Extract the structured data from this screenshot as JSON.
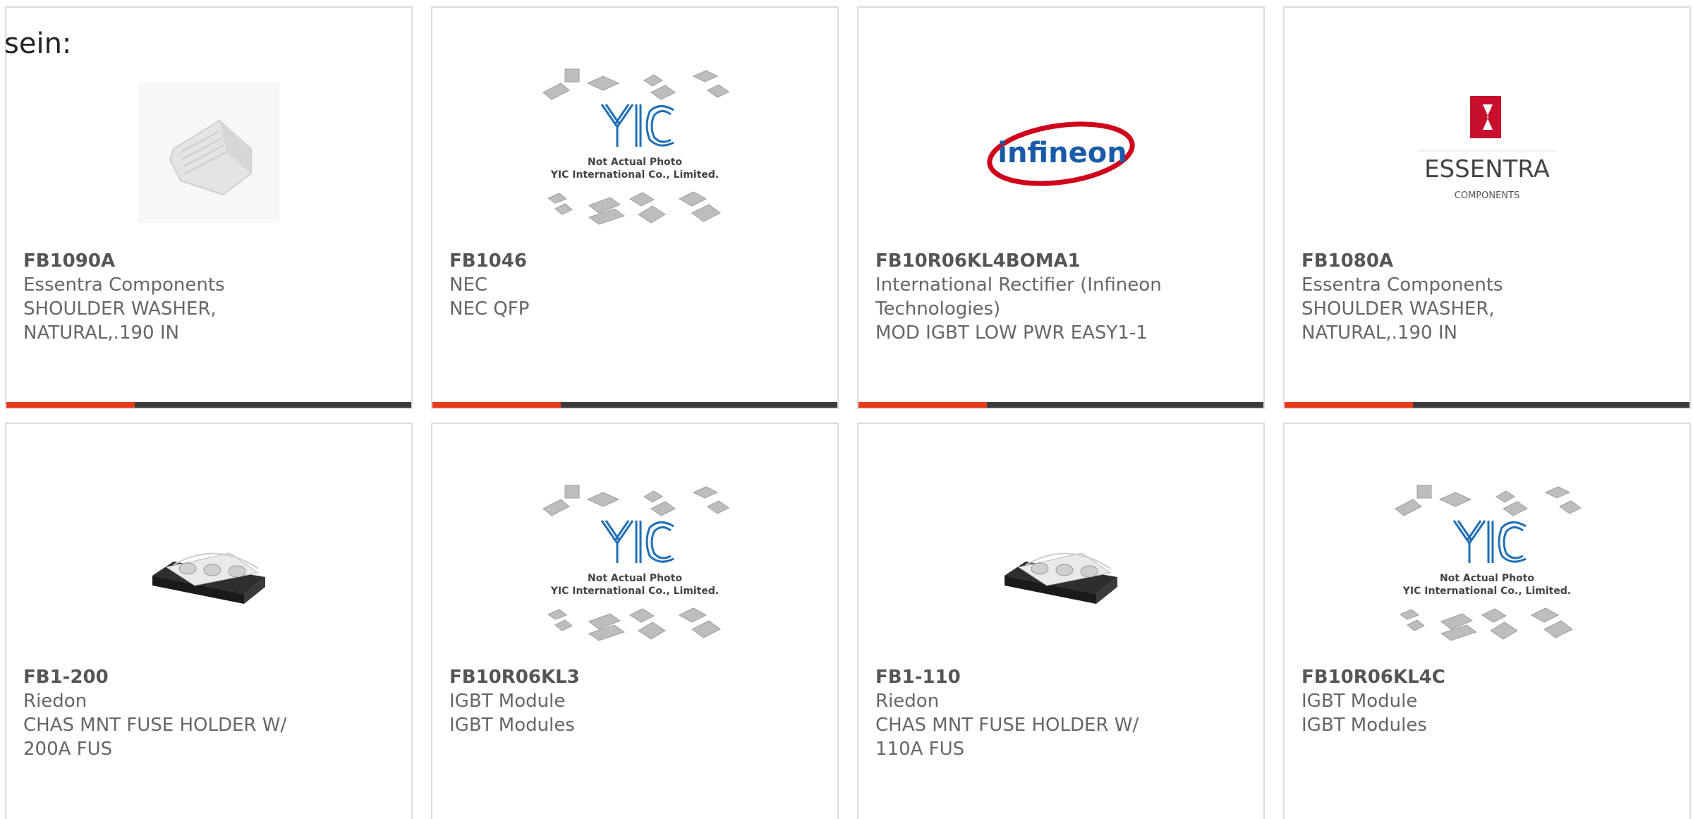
{
  "heading": "sein:",
  "colors": {
    "accent": "#e8391c",
    "bar": "#3b3b3b",
    "border": "#dddddd",
    "text": "#666666",
    "yic_blue": "#1f6fb5",
    "infineon_red": "#d0021b",
    "infineon_blue": "#1a5ba8",
    "essentra_red": "#c8102e"
  },
  "placeholder": {
    "line1": "Not Actual Photo",
    "line2": "YIC International Co., Limited.",
    "logo": "YIC"
  },
  "logos": {
    "infineon": "infineon",
    "essentra_name": "ESSENTRA",
    "essentra_sub": "COMPONENTS"
  },
  "products": [
    {
      "part": "FB1090A",
      "manufacturer": "Essentra Components",
      "desc1": "SHOULDER WASHER,",
      "desc2": "NATURAL,.190 IN",
      "image": "washer-photo"
    },
    {
      "part": "FB1046",
      "manufacturer": "NEC",
      "desc1": "NEC QFP",
      "desc2": "",
      "image": "yic-placeholder"
    },
    {
      "part": "FB10R06KL4BOMA1",
      "manufacturer": "International Rectifier (Infineon",
      "manufacturer2": "Technologies)",
      "desc1": "MOD IGBT LOW PWR EASY1-1",
      "desc2": "",
      "image": "infineon-logo"
    },
    {
      "part": "FB1080A",
      "manufacturer": "Essentra Components",
      "desc1": "SHOULDER WASHER,",
      "desc2": "NATURAL,.190 IN",
      "image": "essentra-logo"
    },
    {
      "part": "FB1-200",
      "manufacturer": "Riedon",
      "desc1": "CHAS MNT FUSE HOLDER W/",
      "desc2": "200A FUS",
      "image": "fuse-holder-photo"
    },
    {
      "part": "FB10R06KL3",
      "manufacturer": "IGBT Module",
      "desc1": "IGBT Modules",
      "desc2": "",
      "image": "yic-placeholder"
    },
    {
      "part": "FB1-110",
      "manufacturer": "Riedon",
      "desc1": "CHAS MNT FUSE HOLDER W/",
      "desc2": "110A FUS",
      "image": "fuse-holder-photo"
    },
    {
      "part": "FB10R06KL4C",
      "manufacturer": "IGBT Module",
      "desc1": "IGBT Modules",
      "desc2": "",
      "image": "yic-placeholder"
    }
  ]
}
